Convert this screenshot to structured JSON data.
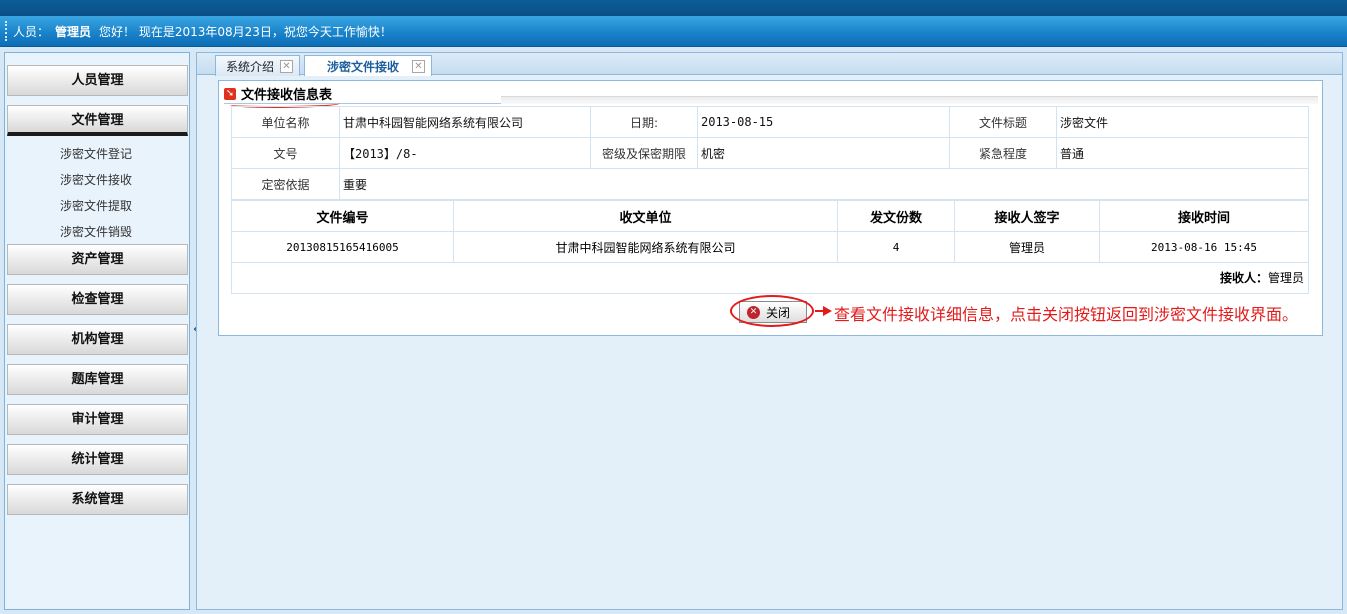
{
  "header": {
    "user_label": "人员：",
    "user_name": "管理员",
    "greeting": "您好！ 现在是2013年08月23日，祝您今天工作愉快！"
  },
  "sidebar": {
    "menus": [
      "人员管理",
      "文件管理",
      "资产管理",
      "检查管理",
      "机构管理",
      "题库管理",
      "审计管理",
      "统计管理",
      "系统管理"
    ],
    "file_submenu": [
      "涉密文件登记",
      "涉密文件接收",
      "涉密文件提取",
      "涉密文件销毁"
    ],
    "collapse_glyph": "«"
  },
  "tabs": [
    {
      "label": "系统介绍",
      "active": false
    },
    {
      "label": "涉密文件接收",
      "active": true
    }
  ],
  "panel": {
    "title": "文件接收信息表",
    "info": {
      "unit_label": "单位名称",
      "unit_value": "甘肃中科园智能网络系统有限公司",
      "date_label": "日期:",
      "date_value": "2013-08-15",
      "title_label": "文件标题",
      "title_value": "涉密文件",
      "docno_label": "文号",
      "docno_value": "【2013】/8-",
      "level_label": "密级及保密期限",
      "level_value": "机密",
      "urgency_label": "紧急程度",
      "urgency_value": "普通",
      "basis_label": "定密依据",
      "basis_value": "重要"
    },
    "grid": {
      "columns": [
        "文件编号",
        "收文单位",
        "发文份数",
        "接收人签字",
        "接收时间"
      ],
      "rows": [
        [
          "20130815165416005",
          "甘肃中科园智能网络系统有限公司",
          "4",
          "管理员",
          "2013-08-16 15:45"
        ]
      ]
    },
    "receiver_label": "接收人：",
    "receiver_value": "管理员",
    "close_label": "关闭",
    "annotation": "查看文件接收详细信息，点击关闭按钮返回到涉密文件接收界面。"
  },
  "colors": {
    "accent": "#1781c9",
    "annotation": "#e21b1b"
  }
}
